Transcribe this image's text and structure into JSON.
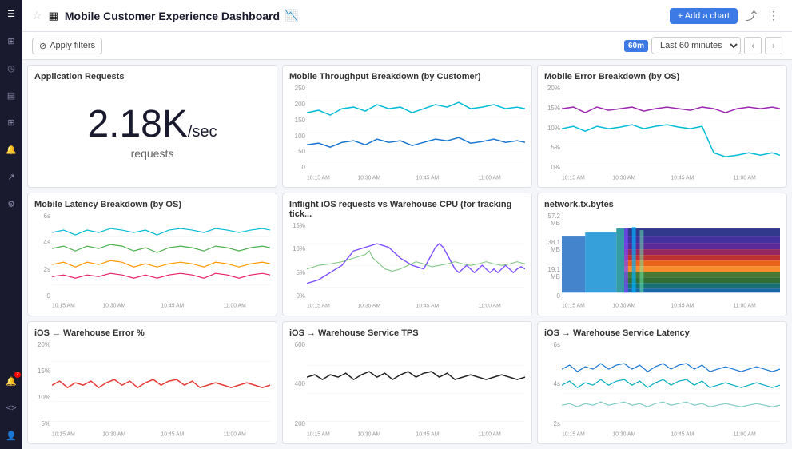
{
  "sidebar": {
    "icons": [
      {
        "name": "menu-icon",
        "symbol": "☰"
      },
      {
        "name": "home-icon",
        "symbol": "⊞"
      },
      {
        "name": "clock-icon",
        "symbol": "◷"
      },
      {
        "name": "document-icon",
        "symbol": "📄"
      },
      {
        "name": "grid-icon",
        "symbol": "⊞"
      },
      {
        "name": "bell-icon",
        "symbol": "🔔"
      },
      {
        "name": "chart-icon",
        "symbol": "↗"
      },
      {
        "name": "settings-icon",
        "symbol": "⚙"
      }
    ]
  },
  "topbar": {
    "title": "Mobile Customer Experience Dashboard",
    "add_chart_label": "+ Add a chart",
    "share_icon": "share",
    "more_icon": "more"
  },
  "filterbar": {
    "apply_filters_label": "Apply filters",
    "time_badge": "60m",
    "time_select_label": "Last 60 minutes",
    "nav_prev": "‹",
    "nav_next": "›"
  },
  "charts": [
    {
      "id": "application-requests",
      "title": "Application Requests",
      "type": "big-number",
      "value": "2.18K",
      "unit": "/sec",
      "label": "requests"
    },
    {
      "id": "mobile-throughput",
      "title": "Mobile Throughput Breakdown (by Customer)",
      "type": "line",
      "y_labels": [
        "250",
        "200",
        "150",
        "100",
        "50",
        "0"
      ]
    },
    {
      "id": "mobile-error-os",
      "title": "Mobile Error Breakdown (by OS)",
      "type": "line",
      "y_labels": [
        "20%",
        "15%",
        "10%",
        "5%",
        "0%"
      ]
    },
    {
      "id": "mobile-latency-os",
      "title": "Mobile Latency Breakdown (by OS)",
      "type": "line",
      "y_labels": [
        "6s",
        "4s",
        "2s",
        "0"
      ]
    },
    {
      "id": "inflight-ios",
      "title": "Inflight iOS requests vs Warehouse CPU (for tracking tick...",
      "type": "line",
      "y_labels": [
        "15%",
        "10%",
        "5%",
        "0%"
      ]
    },
    {
      "id": "network-tx-bytes",
      "title": "network.tx.bytes",
      "type": "area",
      "y_labels": [
        "57.2 MB",
        "38.1 MB",
        "19.1 MB",
        "0"
      ]
    },
    {
      "id": "ios-warehouse-error",
      "title": "iOS → Warehouse Error %",
      "type": "line",
      "y_labels": [
        "20%",
        "15%",
        "10%",
        "5%"
      ]
    },
    {
      "id": "ios-warehouse-tps",
      "title": "iOS → Warehouse Service TPS",
      "type": "line",
      "y_labels": [
        "600",
        "400",
        "200"
      ]
    },
    {
      "id": "ios-warehouse-latency",
      "title": "iOS → Warehouse Service Latency",
      "type": "line",
      "y_labels": [
        "6s",
        "4s",
        "2s"
      ]
    }
  ],
  "x_labels": [
    "10:15 AM",
    "10:30 AM",
    "10:45 AM",
    "11:00 AM"
  ]
}
